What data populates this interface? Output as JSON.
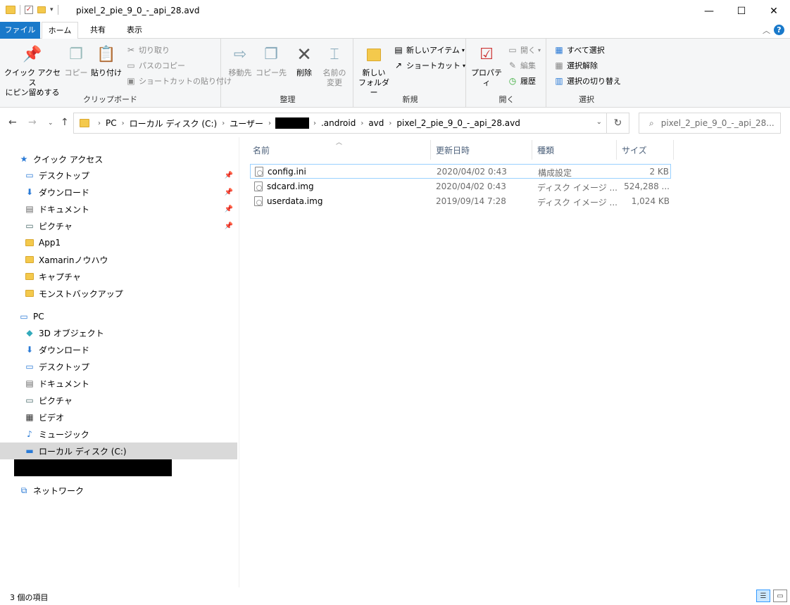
{
  "window": {
    "title": "pixel_2_pie_9_0_-_api_28.avd",
    "minimize": "—",
    "maximize": "☐",
    "close": "✕"
  },
  "tabs": {
    "file": "ファイル",
    "home": "ホーム",
    "share": "共有",
    "view": "表示",
    "help": "?"
  },
  "ribbon": {
    "clipboard": {
      "label": "クリップボード",
      "pin_line1": "クイック アクセス",
      "pin_line2": "にピン留めする",
      "copy": "コピー",
      "paste": "貼り付け",
      "cut": "切り取り",
      "copy_path": "パスのコピー",
      "paste_shortcut": "ショートカットの貼り付け"
    },
    "organize": {
      "label": "整理",
      "move_to": "移動先",
      "copy_to": "コピー先",
      "delete": "削除",
      "rename_line1": "名前の",
      "rename_line2": "変更"
    },
    "new": {
      "label": "新規",
      "new_folder_line1": "新しい",
      "new_folder_line2": "フォルダー",
      "new_item": "新しいアイテム",
      "shortcut": "ショートカット"
    },
    "open": {
      "label": "開く",
      "properties": "プロパティ",
      "open": "開く",
      "edit": "編集",
      "history": "履歴"
    },
    "select": {
      "label": "選択",
      "select_all": "すべて選択",
      "select_none": "選択解除",
      "invert": "選択の切り替え"
    }
  },
  "address": {
    "crumbs": [
      "PC",
      "ローカル ディスク (C:)",
      "ユーザー",
      ".android",
      "avd",
      "pixel_2_pie_9_0_-_api_28.avd"
    ],
    "search_placeholder": "pixel_2_pie_9_0_-_api_28..."
  },
  "sidebar": {
    "quick_access": "クイック アクセス",
    "quick_items": [
      "デスクトップ",
      "ダウンロード",
      "ドキュメント",
      "ピクチャ",
      "App1",
      "Xamarinノウハウ",
      "キャプチャ",
      "モンストバックアップ"
    ],
    "pc": "PC",
    "pc_items": [
      "3D オブジェクト",
      "ダウンロード",
      "デスクトップ",
      "ドキュメント",
      "ピクチャ",
      "ビデオ",
      "ミュージック",
      "ローカル ディスク (C:)"
    ],
    "network": "ネットワーク"
  },
  "columns": {
    "name": "名前",
    "date": "更新日時",
    "type": "種類",
    "size": "サイズ"
  },
  "files": [
    {
      "name": "config.ini",
      "date": "2020/04/02 0:43",
      "type": "構成設定",
      "size": "2 KB"
    },
    {
      "name": "sdcard.img",
      "date": "2020/04/02 0:43",
      "type": "ディスク イメージ ...",
      "size": "524,288 ..."
    },
    {
      "name": "userdata.img",
      "date": "2019/09/14 7:28",
      "type": "ディスク イメージ ...",
      "size": "1,024 KB"
    }
  ],
  "status": {
    "count": "3 個の項目"
  }
}
